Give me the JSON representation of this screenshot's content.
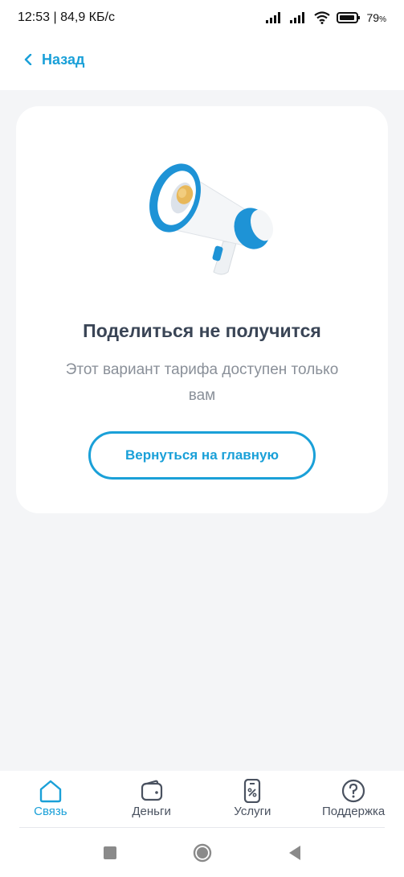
{
  "status_bar": {
    "time_speed": "12:53 | 84,9 КБ/с",
    "battery": "79",
    "battery_unit": "%"
  },
  "top_nav": {
    "back_label": "Назад"
  },
  "card": {
    "title": "Поделиться не получится",
    "text": "Этот вариант тарифа доступен только вам",
    "button_label": "Вернуться на главную"
  },
  "bottom_nav": {
    "items": [
      {
        "label": "Связь",
        "icon": "home-icon",
        "active": true
      },
      {
        "label": "Деньги",
        "icon": "wallet-icon",
        "active": false
      },
      {
        "label": "Услуги",
        "icon": "services-icon",
        "active": false
      },
      {
        "label": "Поддержка",
        "icon": "help-icon",
        "active": false
      }
    ]
  },
  "colors": {
    "accent": "#1aa0d8",
    "background": "#f4f5f7",
    "title": "#3a4556",
    "muted": "#8a9099"
  }
}
